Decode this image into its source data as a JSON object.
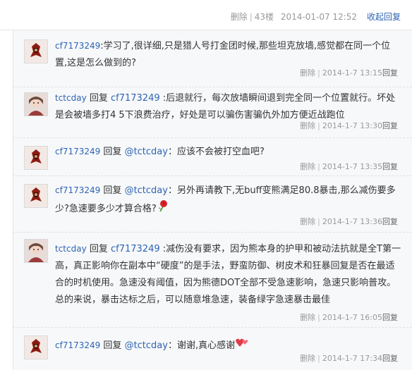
{
  "floor_header": {
    "delete_label": "删除",
    "floor": "43楼",
    "timestamp": "2014-01-07 12:52",
    "collapse_label": "收起回复"
  },
  "replies": [
    {
      "user": "cf7173249",
      "text": "学习了,很详细,只是猎人号打金团时候,那些坦克放墙,感觉都在同一个位置,这是怎么做到的?",
      "delete_label": "删除",
      "time": "2014-1-7 13:15",
      "reply_label": "回复",
      "avatar": "horde-emblem-avatar"
    },
    {
      "user": "tctcday",
      "reply_word": "回复",
      "target": "cf7173249",
      "text": ":后退就行，每次放墙瞬间退到完全同一个位置就行。坏处是会被墙多打4 5下浪费治疗，好处是可以骗伤害骗仇外加方便近战跑位",
      "delete_label": "删除",
      "time": "2014-1-7 13:30",
      "reply_label": "回复",
      "avatar": "character-portrait-avatar"
    },
    {
      "user": "cf7173249",
      "reply_word": "回复",
      "target": "@tctcday",
      "text": "：应该不会被打空血吧?",
      "delete_label": "删除",
      "time": "2014-1-7 13:35",
      "reply_label": "回复",
      "avatar": "horde-emblem-avatar"
    },
    {
      "user": "cf7173249",
      "reply_word": "回复",
      "target": "@tctcday",
      "text": "：另外再请教下,无buff变熊满足80.8暴击,那么减伤要多少?急速要多少才算合格?",
      "delete_label": "删除",
      "time": "2014-1-7 13:36",
      "reply_label": "回复",
      "avatar": "horde-emblem-avatar",
      "emoji": "rose-emoji"
    },
    {
      "user": "tctcday",
      "reply_word": "回复",
      "target": "cf7173249",
      "text": ":减伤没有要求，因为熊本身的护甲和被动法抗就是全T第一高，真正影响你在副本中“硬度”的是手法，野蛮防御、树皮术和狂暴回复是否在最适合的时机使用。急速没有阈值，因为熊德DOT全部不受急速影响，急速只影响普攻。总的来说，暴击达标之后，可以随意堆急速，装备绿字急速暴击最佳",
      "delete_label": "删除",
      "time": "2014-1-7 16:05",
      "reply_label": "回复",
      "avatar": "character-portrait-avatar"
    },
    {
      "user": "cf7173249",
      "reply_word": "回复",
      "target": "@tctcday",
      "text": "：谢谢,真心感谢",
      "delete_label": "删除",
      "time": "2014-1-7 17:34",
      "reply_label": "回复",
      "avatar": "horde-emblem-avatar",
      "emoji": "heart-emoji"
    }
  ]
}
